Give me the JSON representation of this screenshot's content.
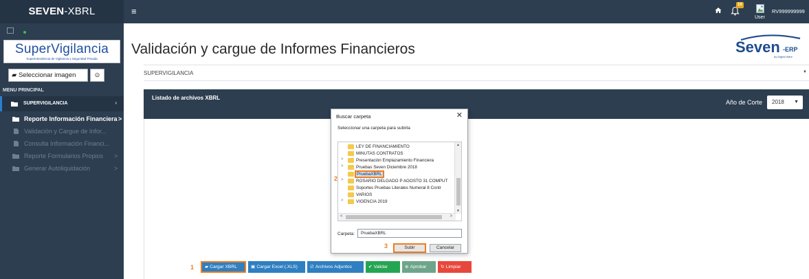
{
  "topbar": {
    "brand_bold": "SEVEN",
    "brand_light": "-XBRL",
    "notification_count": "10",
    "user_label": "User",
    "user_id": "RV999999999"
  },
  "sidebar": {
    "logo_text": "SuperVigilancia",
    "logo_subtitle": "Superintendencia de Vigilancia y Seguridad Privada",
    "select_image_label": "Seleccionar imagen",
    "menu_title": "MENU PRINCIPAL",
    "active_item": "SUPERVIGILANCIA",
    "items": [
      {
        "label": "Reporte Información Financiera",
        "arrow": ">"
      },
      {
        "label": "Validación y Cargue de Infor..."
      },
      {
        "label": "Consulta Información Financi..."
      },
      {
        "label": "Reporte Formularios Propios",
        "arrow": ">"
      },
      {
        "label": "Generar Autoliquidación",
        "arrow": ">"
      }
    ]
  },
  "header": {
    "page_title": "Validación y cargue de Informes Financieros",
    "logo_main": "Seven",
    "logo_suffix": "-ERP",
    "logo_by": "by Digital Ware",
    "entity_select": "SUPERVIGILANCIA"
  },
  "panel": {
    "title": "Listado de archivos XBRL",
    "year_label": "Año de Corte",
    "year_value": "2018"
  },
  "dialog": {
    "title": "Buscar carpeta",
    "instruction": "Seleccionar una carpeta para subirla",
    "folders": [
      {
        "name": "LEY DE FINANCIAMIENTO",
        "expandable": false
      },
      {
        "name": "MINUTAS CONTRATOS",
        "expandable": false
      },
      {
        "name": "Presentación Emplazamiento Financiera",
        "expandable": true
      },
      {
        "name": "Pruebas Seven Diciembre 2018",
        "expandable": true
      },
      {
        "name": "PruebaXBRL",
        "expandable": false,
        "selected": true
      },
      {
        "name": "ROSARIO DELGADO P AGOSTO 31 COMPUT",
        "expandable": true
      },
      {
        "name": "Soportes Pruebas Literales Numeral 8 Contr",
        "expandable": false
      },
      {
        "name": "VARIOS",
        "expandable": false
      },
      {
        "name": "VIGENCIA 2019",
        "expandable": true
      }
    ],
    "folder_label": "Carpeta:",
    "folder_value": "PruebaXBRL",
    "submit_label": "Subir",
    "cancel_label": "Cancelar"
  },
  "steps": [
    "1",
    "2",
    "3"
  ],
  "actions": {
    "upload_xbrl": "Cargar XBRL",
    "upload_excel": "Cargar Excel (.XLS)",
    "attachments": "Archivos Adjuntos",
    "validate": "Validar",
    "approve": "Aprobar",
    "clear": "Limpiar"
  },
  "colors": {
    "nav_dark": "#2d3e50",
    "accent_orange": "#f07c1f",
    "blue": "#2f7fc1",
    "green": "#25a553",
    "red": "#e8473b"
  }
}
